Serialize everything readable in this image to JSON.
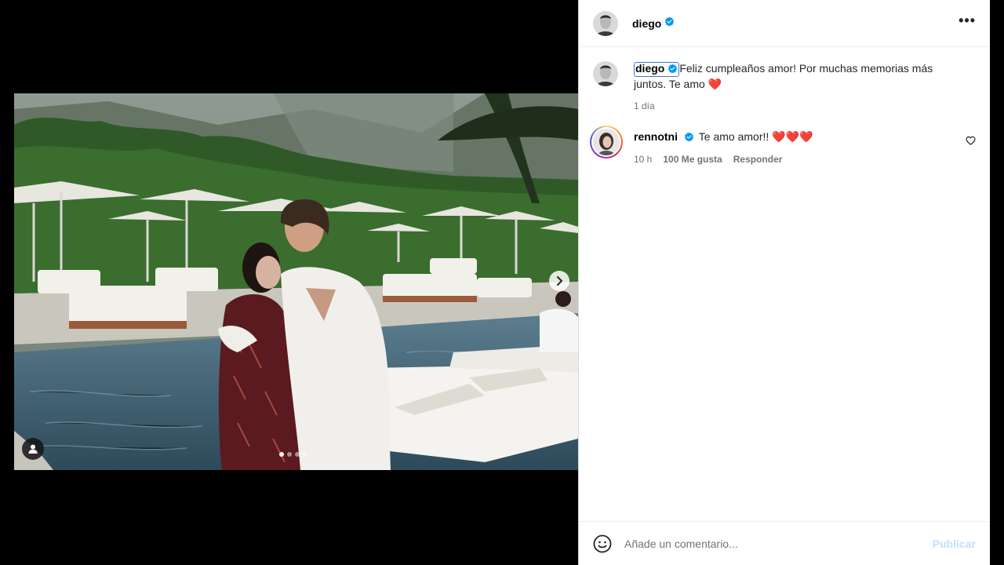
{
  "post": {
    "author": "diego",
    "caption": "Feliz cumpleaños amor! Por muchas memorias más juntos. Te amo ❤️",
    "time": "1 día",
    "carousel": {
      "total": 4,
      "current": 1
    }
  },
  "comments": [
    {
      "username": "rennotni",
      "text": "Te amo amor!! ❤️❤️❤️",
      "time": "10 h",
      "likes": "100 Me gusta",
      "reply_label": "Responder"
    }
  ],
  "composer": {
    "placeholder": "Añade un comentario...",
    "post_label": "Publicar"
  },
  "icons": {
    "verified": "verified-badge-icon",
    "more": "more-options-icon",
    "next": "chevron-right-icon",
    "tag": "user-tag-icon",
    "like": "heart-outline-icon",
    "emoji": "emoji-smile-icon"
  },
  "colors": {
    "verified": "#0095f6",
    "post_disabled": "#c0dffd",
    "meta": "#737373"
  }
}
